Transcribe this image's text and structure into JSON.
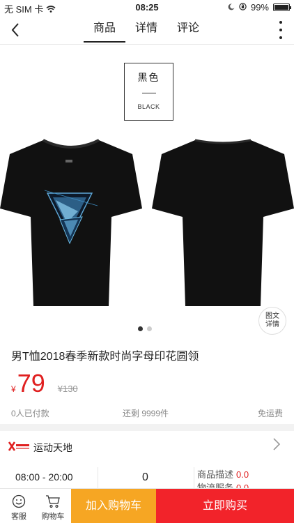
{
  "status_bar": {
    "carrier": "无 SIM 卡",
    "time": "08:25",
    "battery": "99%",
    "battery_level": 0.99
  },
  "nav": {
    "tabs": [
      {
        "label": "商品",
        "active": true
      },
      {
        "label": "详情",
        "active": false
      },
      {
        "label": "评论",
        "active": false
      }
    ]
  },
  "gallery": {
    "color_label_zh": "黑色",
    "color_label_en": "BLACK",
    "detail_badge": "图文\n详情",
    "image_count": 2,
    "current_index": 0
  },
  "product": {
    "title": "男T恤2018春季新款时尚字母印花圆领",
    "currency_symbol": "¥",
    "price": "79",
    "original_price": "¥130",
    "paid_count": "0人已付款",
    "stock": "还剩 9999件",
    "shipping": "免运费"
  },
  "store": {
    "name": "运动天地",
    "hours": "08:00 - 20:00",
    "count": "0",
    "desc_label": "商品描述",
    "desc_score": "0.0",
    "logistics_label": "物流服务",
    "logistics_score": "0.0"
  },
  "bottom_bar": {
    "service_label": "客服",
    "cart_label": "购物车",
    "add_to_cart": "加入购物车",
    "buy_now": "立即购买"
  },
  "colors": {
    "accent_red": "#f2232a",
    "accent_orange": "#f6a623",
    "price_red": "#e02020"
  }
}
